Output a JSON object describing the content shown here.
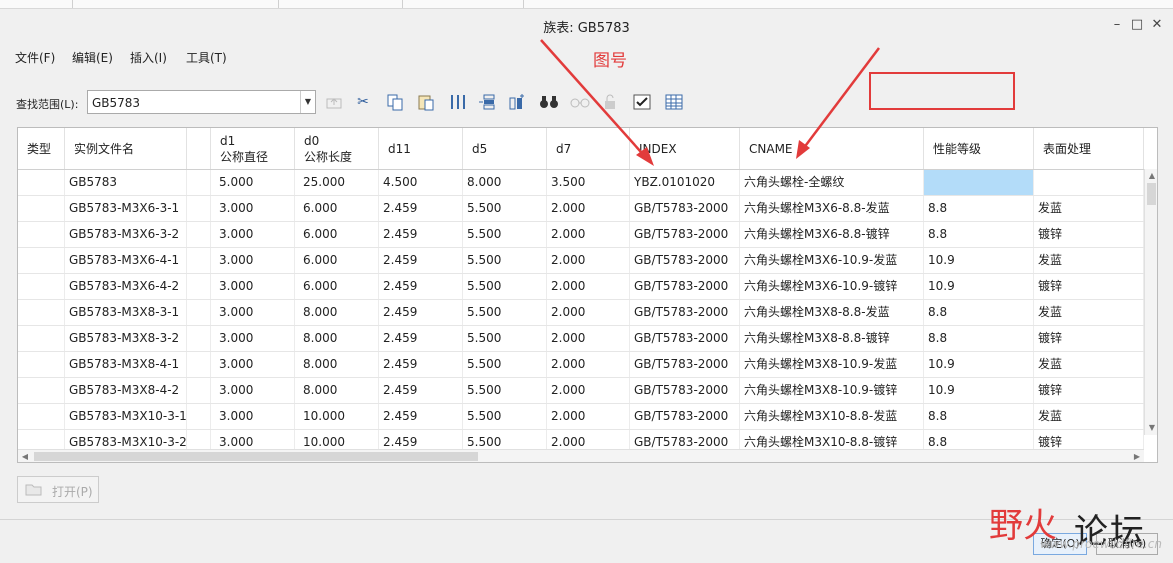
{
  "window": {
    "title": "族表: GB5783",
    "minimize_icon": "minimize-icon",
    "maximize_icon": "maximize-icon",
    "close_icon": "close-icon"
  },
  "menu": [
    {
      "label": "文件(F)"
    },
    {
      "label": "编辑(E)"
    },
    {
      "label": "插入(I)"
    },
    {
      "label": "工具(T)"
    }
  ],
  "lookin": {
    "label": "查找范围(L):",
    "value": "GB5783"
  },
  "toolbar": [
    {
      "icon": "up-folder-icon",
      "enabled": false
    },
    {
      "icon": "cut-icon",
      "enabled": true
    },
    {
      "icon": "copy-icon",
      "enabled": true
    },
    {
      "icon": "paste-icon",
      "enabled": true
    },
    {
      "icon": "insert-column-icon",
      "enabled": true
    },
    {
      "icon": "insert-row-icon",
      "enabled": true
    },
    {
      "icon": "insert-item-icon",
      "enabled": true
    },
    {
      "icon": "binoculars-icon",
      "enabled": true
    },
    {
      "icon": "glasses-icon",
      "enabled": false
    },
    {
      "icon": "lock-icon",
      "enabled": false
    },
    {
      "icon": "verify-icon",
      "enabled": true
    },
    {
      "icon": "table-icon",
      "enabled": true
    }
  ],
  "annotation": {
    "label": "图号",
    "color": "#e23b3b"
  },
  "table": {
    "columns": [
      {
        "line1": "类型",
        "line2": ""
      },
      {
        "line1": "实例文件名",
        "line2": ""
      },
      {
        "line1": "",
        "line2": ""
      },
      {
        "line1": "d1",
        "line2": "公称直径"
      },
      {
        "line1": "d0",
        "line2": "公称长度"
      },
      {
        "line1": "d11",
        "line2": ""
      },
      {
        "line1": "d5",
        "line2": ""
      },
      {
        "line1": "d7",
        "line2": ""
      },
      {
        "line1": "INDEX",
        "line2": ""
      },
      {
        "line1": "CNAME",
        "line2": ""
      },
      {
        "line1": "性能等级",
        "line2": ""
      },
      {
        "line1": "表面处理",
        "line2": ""
      }
    ],
    "rows": [
      [
        "",
        "GB5783",
        "",
        "5.000",
        "25.000",
        "4.500",
        "8.000",
        "3.500",
        "YBZ.0101020",
        "六角头螺栓-全螺纹",
        "",
        ""
      ],
      [
        "",
        "GB5783-M3X6-3-1",
        "",
        "3.000",
        "6.000",
        "2.459",
        "5.500",
        "2.000",
        "GB/T5783-2000",
        "六角头螺栓M3X6-8.8-发蓝",
        "8.8",
        "发蓝"
      ],
      [
        "",
        "GB5783-M3X6-3-2",
        "",
        "3.000",
        "6.000",
        "2.459",
        "5.500",
        "2.000",
        "GB/T5783-2000",
        "六角头螺栓M3X6-8.8-镀锌",
        "8.8",
        "镀锌"
      ],
      [
        "",
        "GB5783-M3X6-4-1",
        "",
        "3.000",
        "6.000",
        "2.459",
        "5.500",
        "2.000",
        "GB/T5783-2000",
        "六角头螺栓M3X6-10.9-发蓝",
        "10.9",
        "发蓝"
      ],
      [
        "",
        "GB5783-M3X6-4-2",
        "",
        "3.000",
        "6.000",
        "2.459",
        "5.500",
        "2.000",
        "GB/T5783-2000",
        "六角头螺栓M3X6-10.9-镀锌",
        "10.9",
        "镀锌"
      ],
      [
        "",
        "GB5783-M3X8-3-1",
        "",
        "3.000",
        "8.000",
        "2.459",
        "5.500",
        "2.000",
        "GB/T5783-2000",
        "六角头螺栓M3X8-8.8-发蓝",
        "8.8",
        "发蓝"
      ],
      [
        "",
        "GB5783-M3X8-3-2",
        "",
        "3.000",
        "8.000",
        "2.459",
        "5.500",
        "2.000",
        "GB/T5783-2000",
        "六角头螺栓M3X8-8.8-镀锌",
        "8.8",
        "镀锌"
      ],
      [
        "",
        "GB5783-M3X8-4-1",
        "",
        "3.000",
        "8.000",
        "2.459",
        "5.500",
        "2.000",
        "GB/T5783-2000",
        "六角头螺栓M3X8-10.9-发蓝",
        "10.9",
        "发蓝"
      ],
      [
        "",
        "GB5783-M3X8-4-2",
        "",
        "3.000",
        "8.000",
        "2.459",
        "5.500",
        "2.000",
        "GB/T5783-2000",
        "六角头螺栓M3X8-10.9-镀锌",
        "10.9",
        "镀锌"
      ],
      [
        "",
        "GB5783-M3X10-3-1",
        "",
        "3.000",
        "10.000",
        "2.459",
        "5.500",
        "2.000",
        "GB/T5783-2000",
        "六角头螺栓M3X10-8.8-发蓝",
        "8.8",
        "发蓝"
      ],
      [
        "",
        "GB5783-M3X10-3-2",
        "",
        "3.000",
        "10.000",
        "2.459",
        "5.500",
        "2.000",
        "GB/T5783-2000",
        "六角头螺栓M3X10-8.8-镀锌",
        "8.8",
        "镀锌"
      ]
    ],
    "selected_cell": {
      "row": 0,
      "col": 10
    }
  },
  "open_button": {
    "label": "打开(P)",
    "icon": "open-folder-icon",
    "enabled": false
  },
  "footer": {
    "ok_label": "确定(O)",
    "cancel_label": "取消(C)"
  },
  "watermark": {
    "text_red": "野火",
    "text_dark": "论坛",
    "url": "www.proewildfire.cn"
  }
}
